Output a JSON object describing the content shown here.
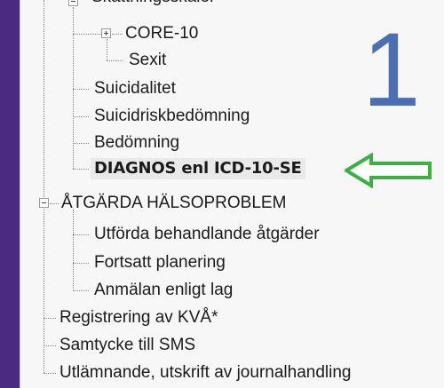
{
  "tree": {
    "clipped_top_label": "Skattningsskalor",
    "items": [
      {
        "label": "CORE-10"
      },
      {
        "label": "Sexit"
      },
      {
        "label": "Suicidalitet"
      },
      {
        "label": "Suicidriskbedömning"
      },
      {
        "label": "Bedömning"
      },
      {
        "label": "DIAGNOS enl ICD-10-SE"
      },
      {
        "label": "ÅTGÄRDA HÄLSOPROBLEM"
      },
      {
        "label": "Utförda behandlande åtgärder"
      },
      {
        "label": "Fortsatt planering"
      },
      {
        "label": "Anmälan enligt lag"
      },
      {
        "label": "Registrering av KVÅ*"
      },
      {
        "label": "Samtycke till SMS"
      },
      {
        "label": "Utlämnande, utskrift av journalhandling"
      }
    ]
  },
  "annotation": {
    "number": "1",
    "arrow_color": "#3cb043",
    "number_color": "#4a6fb5"
  },
  "colors": {
    "background": "#4b2a84",
    "panel": "#f7f7f7"
  }
}
